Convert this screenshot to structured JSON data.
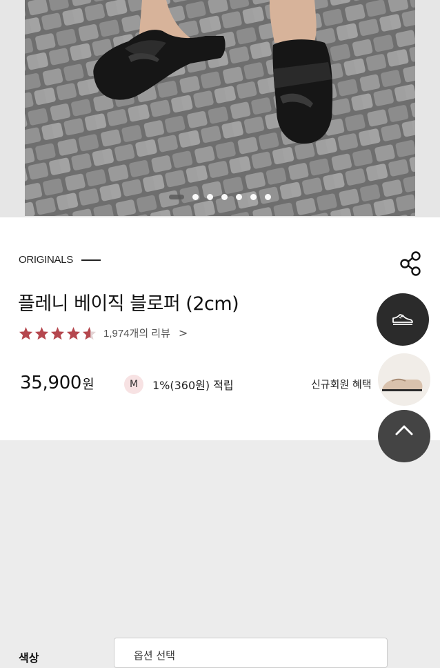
{
  "brand": {
    "name": "ORIGINALS"
  },
  "product": {
    "title": "플레니 베이직 블로퍼 (2cm)",
    "rating": 4.6,
    "review_text": "1,974개의 리뷰",
    "review_chevron": ">",
    "price_number": "35,900",
    "price_unit": "원",
    "member_badge": "M",
    "points_text": "1%(360원) 적립",
    "benefit_text": "신규회원 혜택"
  },
  "gallery": {
    "image_count": 7,
    "active_index": 0
  },
  "options": {
    "color_label": "색상",
    "select_placeholder": "옵션 선택"
  },
  "colors": {
    "star": "#b5474e",
    "badge_bg": "#f7e2e3",
    "fab_dark": "#2b2b2b"
  },
  "icons": [
    "share-icon",
    "shoe-icon",
    "star-icon",
    "chevron-up-icon"
  ]
}
